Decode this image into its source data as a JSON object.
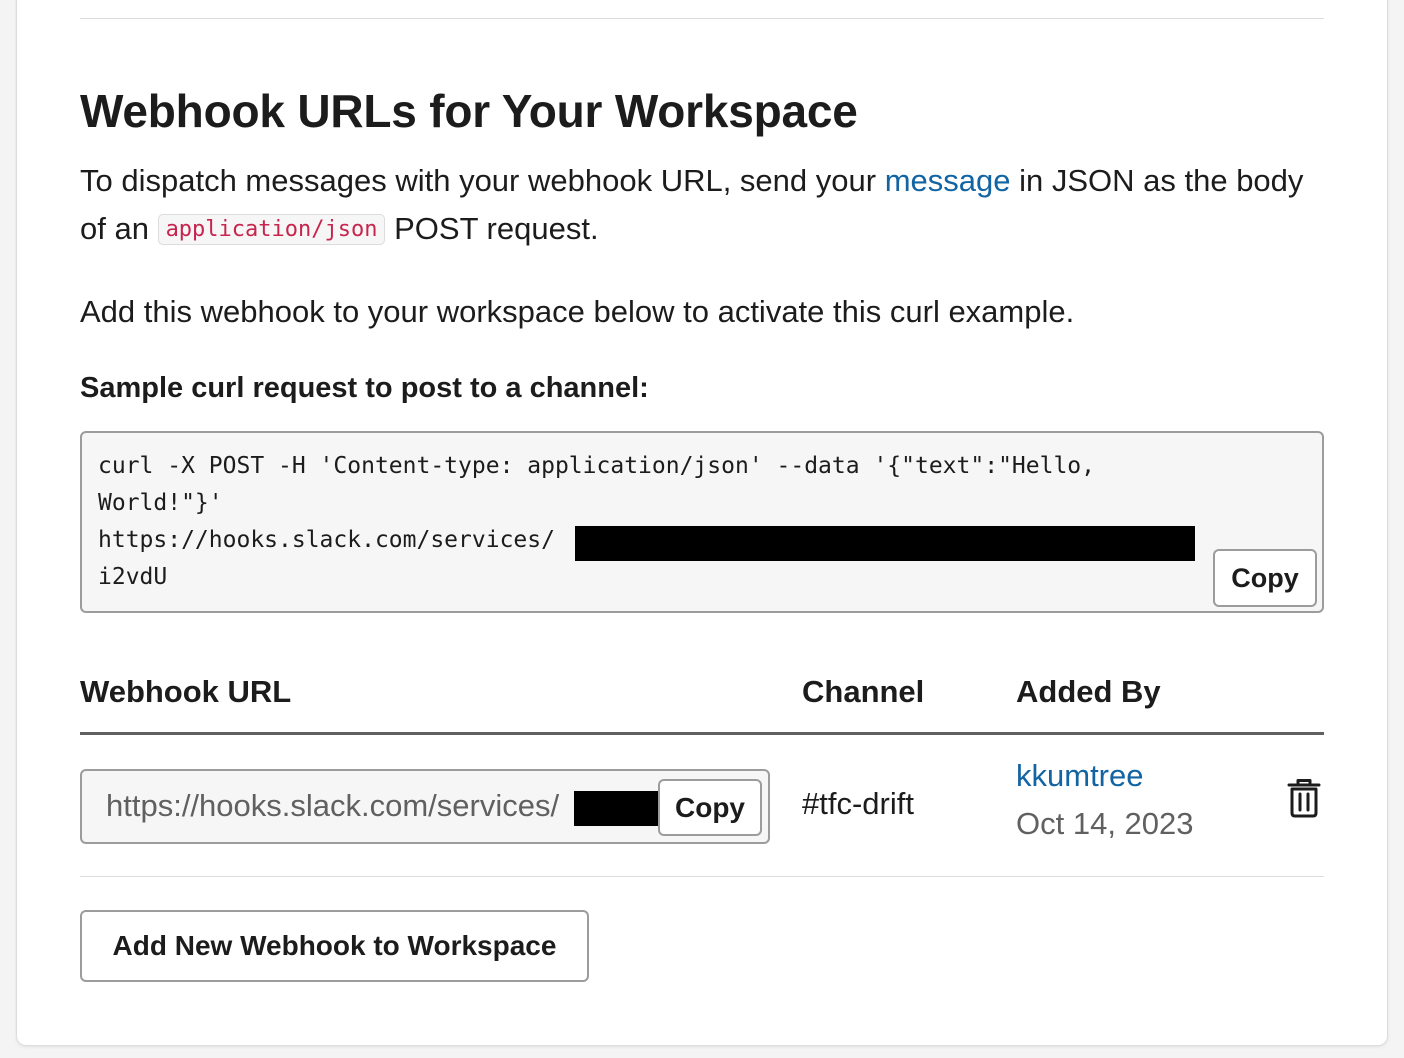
{
  "section": {
    "title": "Webhook URLs for Your Workspace",
    "intro_before_link": "To dispatch messages with your webhook URL, send your ",
    "intro_link": "message",
    "intro_after_link": " in JSON as the body of an ",
    "intro_code": "application/json",
    "intro_end": " POST request.",
    "activate_note": "Add this webhook to your workspace below to activate this curl example."
  },
  "curl": {
    "heading": "Sample curl request to post to a channel:",
    "line1": "curl -X POST -H 'Content-type: application/json' --data '{\"text\":\"Hello,",
    "line2": "World!\"}'",
    "line3": "https://hooks.slack.com/services/",
    "line4": "i2vdU",
    "copy_label": "Copy"
  },
  "table": {
    "headers": {
      "webhook_url": "Webhook URL",
      "channel": "Channel",
      "added_by": "Added By"
    },
    "rows": [
      {
        "url_value": "https://hooks.slack.com/services/",
        "copy_label": "Copy",
        "channel": "#tfc-drift",
        "user": "kkumtree",
        "date": "Oct 14, 2023"
      }
    ]
  },
  "add_button_label": "Add New Webhook to Workspace",
  "icons": {
    "delete": "trash-icon"
  },
  "colors": {
    "link": "#1264a3",
    "code": "#c7254e",
    "muted": "#616061"
  }
}
